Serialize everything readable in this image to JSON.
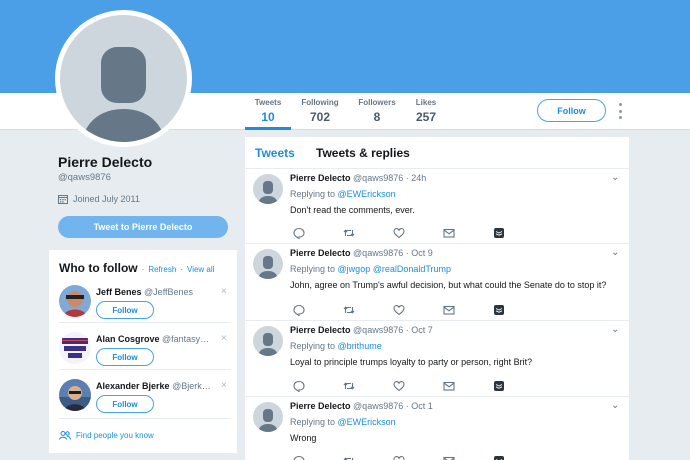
{
  "colors": {
    "accent": "#1d8ce0",
    "banner": "#4b9fe6",
    "muted": "#657786"
  },
  "nav": {
    "stats": [
      {
        "label": "Tweets",
        "value": "10"
      },
      {
        "label": "Following",
        "value": "702"
      },
      {
        "label": "Followers",
        "value": "8"
      },
      {
        "label": "Likes",
        "value": "257"
      }
    ],
    "follow_label": "Follow"
  },
  "profile": {
    "name": "Pierre Delecto",
    "handle": "@qaws9876",
    "joined": "Joined July 2011",
    "tweet_to_label": "Tweet to Pierre Delecto"
  },
  "who_to_follow": {
    "title": "Who to follow",
    "refresh": "Refresh",
    "view_all": "View all",
    "separator": "·",
    "suggestions": [
      {
        "name": "Jeff Benes",
        "handle": "@JeffBenes",
        "button": "Follow",
        "dismiss": "×"
      },
      {
        "name": "Alan Cosgrove",
        "handle": "@fantasy…",
        "button": "Follow",
        "dismiss": "×"
      },
      {
        "name": "Alexander Bjerke",
        "handle": "@Bjerk…",
        "button": "Follow",
        "dismiss": "×"
      }
    ],
    "find_people": "Find people you know"
  },
  "timeline": {
    "tabs": [
      "Tweets",
      "Tweets & replies"
    ],
    "tweets": [
      {
        "name": "Pierre Delecto",
        "handle": "@qaws9876",
        "sep": "·",
        "time": "24h",
        "replying_to": "Replying to",
        "mentions": [
          "@EWErickson"
        ],
        "text": "Don't read the comments, ever."
      },
      {
        "name": "Pierre Delecto",
        "handle": "@qaws9876",
        "sep": "·",
        "time": "Oct 9",
        "replying_to": "Replying to",
        "mentions": [
          "@jwgop",
          "@realDonaldTrump"
        ],
        "text": "John, agree on Trump's awful decision, but what could the Senate do to stop it?"
      },
      {
        "name": "Pierre Delecto",
        "handle": "@qaws9876",
        "sep": "·",
        "time": "Oct 7",
        "replying_to": "Replying to",
        "mentions": [
          "@brithume"
        ],
        "text": "Loyal to principle trumps loyalty to party or person, right Brit?"
      },
      {
        "name": "Pierre Delecto",
        "handle": "@qaws9876",
        "sep": "·",
        "time": "Oct 1",
        "replying_to": "Replying to",
        "mentions": [
          "@EWErickson"
        ],
        "text": "Wrong"
      }
    ]
  },
  "icons": {
    "reply": "reply-icon",
    "retweet": "retweet-icon",
    "like": "heart-icon",
    "dm": "envelope-icon",
    "buffer": "buffer-icon",
    "chevron": "chevron-down-icon"
  }
}
